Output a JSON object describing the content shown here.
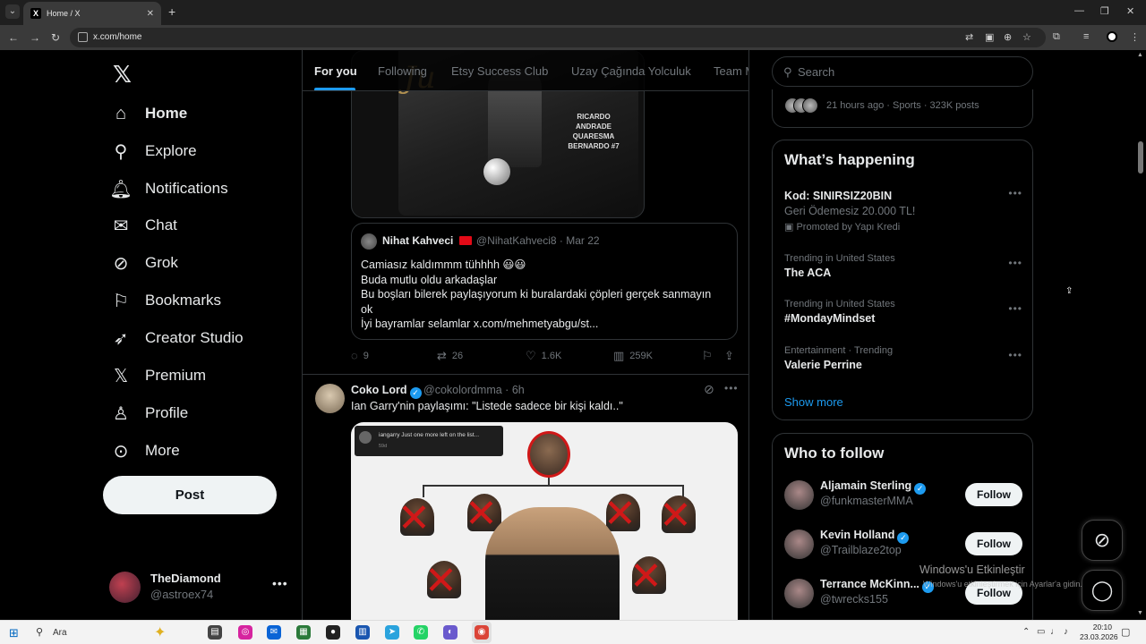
{
  "browser": {
    "tab_title": "Home / X",
    "tab_favicon": "X",
    "url": "x.com/home",
    "colors": {
      "tabstrip": "#1f1f1f",
      "toolbar": "#3a3a3a"
    }
  },
  "sidebar": {
    "logo": "𝕏",
    "items": [
      {
        "label": "Home",
        "icon": "home-icon",
        "glyph": "⌂",
        "active": true
      },
      {
        "label": "Explore",
        "icon": "search-icon",
        "glyph": "⚲"
      },
      {
        "label": "Notifications",
        "icon": "bell-icon",
        "glyph": "🔔︎"
      },
      {
        "label": "Chat",
        "icon": "mail-icon",
        "glyph": "✉"
      },
      {
        "label": "Grok",
        "icon": "grok-icon",
        "glyph": "⊘"
      },
      {
        "label": "Bookmarks",
        "icon": "bookmark-icon",
        "glyph": "⚐"
      },
      {
        "label": "Creator Studio",
        "icon": "rocket-icon",
        "glyph": "➶"
      },
      {
        "label": "Premium",
        "icon": "x-logo-icon",
        "glyph": "𝕏"
      },
      {
        "label": "Profile",
        "icon": "person-icon",
        "glyph": "♙"
      },
      {
        "label": "More",
        "icon": "more-circle-icon",
        "glyph": "⊙"
      }
    ],
    "post_label": "Post",
    "account": {
      "name": "TheDiamond",
      "handle": "@astroex74"
    }
  },
  "feed": {
    "tabs": [
      "For you",
      "Following",
      "Etsy Success Club",
      "Uzay Çağında Yolculuk",
      "Team M"
    ],
    "media_top": {
      "signature": "Ju",
      "jersey_text": "RICARDO ANDRADE QUARESMA BERNARDO #7"
    },
    "quote": {
      "name": "Nihat Kahveci",
      "handle": "@NihatKahveci8 · Mar 22",
      "lines": [
        "Camiasız kaldımmm tühhhh 😃😃",
        "Buda mutlu oldu  arkadaşlar",
        "Bu boşları bilerek paylaşıyorum ki buralardaki çöpleri gerçek sanmayın",
        "ok",
        "İyi bayramlar selamlar x.com/mehmetyabgu/st..."
      ]
    },
    "actions": {
      "replies": "9",
      "reposts": "26",
      "likes": "1.6K",
      "views": "259K"
    },
    "post2": {
      "name": "Coko Lord",
      "handle": "@cokolordmma · 6h",
      "text": "Ian Garry'nin paylaşımı: \"Listede sadece bir kişi kaldı..\"",
      "embed_user": "iangarry",
      "embed_text": "Just one more left on the list...",
      "embed_time": "59d"
    }
  },
  "right": {
    "search_placeholder": "Search",
    "top_trend_meta": "21 hours ago · Sports · 323K posts",
    "happening_title": "What’s happening",
    "trends": [
      {
        "context": "",
        "name": "Kod: SINIRSIZ20BIN",
        "sub": "Geri Ödemesiz 20.000 TL!",
        "promo": "Promoted by Yapı Kredi"
      },
      {
        "context": "Trending in United States",
        "name": "The ACA"
      },
      {
        "context": "Trending in United States",
        "name": "#MondayMindset"
      },
      {
        "context": "Entertainment · Trending",
        "name": "Valerie Perrine"
      }
    ],
    "show_more": "Show more",
    "wtf_title": "Who to follow",
    "follow_label": "Follow",
    "suggestions": [
      {
        "name": "Aljamain Sterling",
        "handle": "@funkmasterMMA"
      },
      {
        "name": "Kevin Holland",
        "handle": "@Trailblaze2top"
      },
      {
        "name": "Terrance McKinn...",
        "handle": "@twrecks155"
      }
    ]
  },
  "overlay": {
    "activation_title": "Windows'u Etkinleştir",
    "activation_sub": "Windows'u etkinleştirmek için Ayarlar'a gidin."
  },
  "taskbar": {
    "search_label": "Ara",
    "time": "20:10",
    "date": "23.03.2026"
  },
  "colors": {
    "accent": "#1d9bf0",
    "background": "#000000",
    "border": "#2f3336",
    "muted": "#71767b"
  }
}
